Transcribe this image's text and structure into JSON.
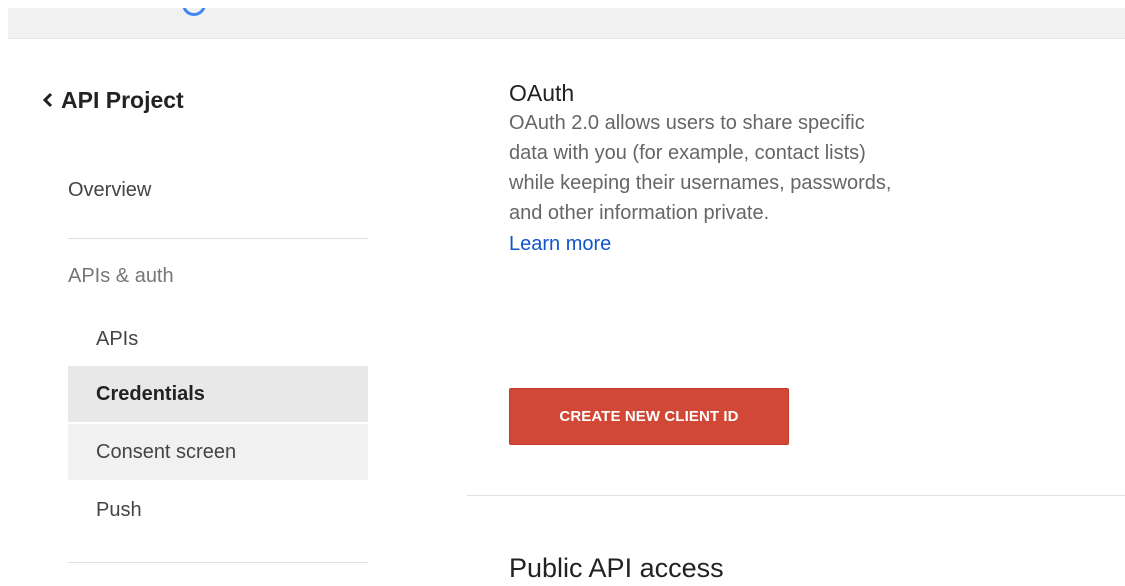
{
  "header": {
    "logo_icon": "google-logo-icon",
    "accent_color": "#4285f4"
  },
  "sidebar": {
    "back_icon": "chevron-left-icon",
    "project_title": "API Project",
    "overview": "Overview",
    "section_label": "APIs & auth",
    "items": [
      {
        "label": "APIs",
        "selected": false
      },
      {
        "label": "Credentials",
        "selected": true
      },
      {
        "label": "Consent screen",
        "selected": false,
        "hovered": true
      },
      {
        "label": "Push",
        "selected": false
      }
    ]
  },
  "main": {
    "oauth": {
      "title": "OAuth",
      "description": "OAuth 2.0 allows users to share specific data with you (for example, contact lists) while keeping their usernames, passwords, and other information private.",
      "learn_more": "Learn more",
      "create_button": "CREATE NEW CLIENT ID",
      "button_color": "#d14836"
    },
    "public_api": {
      "title": "Public API access"
    }
  }
}
